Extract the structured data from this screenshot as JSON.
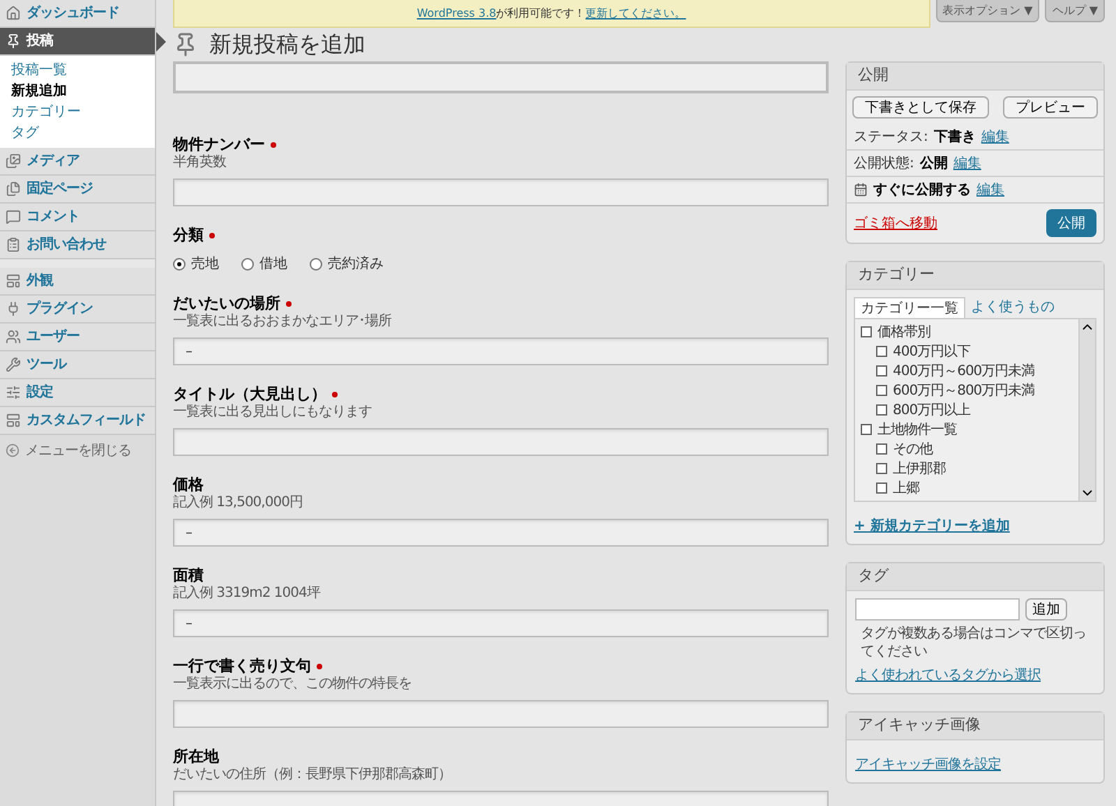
{
  "sidebar": {
    "items": [
      {
        "label": "ダッシュボード",
        "selected": false,
        "group_start": false
      },
      {
        "label": "投稿",
        "selected": true,
        "group_start": false,
        "children": [
          {
            "label": "投稿一覧",
            "selected": false
          },
          {
            "label": "新規追加",
            "selected": true
          },
          {
            "label": "カテゴリー",
            "selected": false
          },
          {
            "label": "タグ",
            "selected": false
          }
        ]
      },
      {
        "label": "メディア",
        "selected": false,
        "group_start": false
      },
      {
        "label": "固定ページ",
        "selected": false,
        "group_start": false
      },
      {
        "label": "コメント",
        "selected": false,
        "group_start": false
      },
      {
        "label": "お問い合わせ",
        "selected": false,
        "group_start": false
      },
      {
        "label": "外観",
        "selected": false,
        "group_start": true
      },
      {
        "label": "プラグイン",
        "selected": false,
        "group_start": false
      },
      {
        "label": "ユーザー",
        "selected": false,
        "group_start": false
      },
      {
        "label": "ツール",
        "selected": false,
        "group_start": false
      },
      {
        "label": "設定",
        "selected": false,
        "group_start": false
      },
      {
        "label": "カスタムフィールド",
        "selected": false,
        "group_start": false
      }
    ],
    "collapse": "メニューを閉じる"
  },
  "notice": [
    {
      "text": "WordPress 3.8",
      "link": true
    },
    {
      "text": " が利用可能です！",
      "link": false
    },
    {
      "text": "更新してください。",
      "link": true
    }
  ],
  "screen_tabs": [
    "表示オプション ▼",
    "ヘルプ ▼"
  ],
  "page_title": "新規投稿を追加",
  "fields": [
    {
      "kind": "text",
      "label": "物件ナンバー",
      "required": true,
      "hint": "半角英数"
    },
    {
      "kind": "radio",
      "label": "分類",
      "required": true,
      "options": [
        {
          "label": "売地",
          "selected": true
        },
        {
          "label": "借地",
          "selected": false
        },
        {
          "label": "売約済み",
          "selected": false
        }
      ]
    },
    {
      "kind": "text",
      "label": "だいたいの場所",
      "required": true,
      "hint": "一覧表に出るおおまかなエリア･場所",
      "value": "–"
    },
    {
      "kind": "text",
      "label": "タイトル（大見出し）",
      "required": true,
      "hint": "一覧表に出る見出しにもなります"
    },
    {
      "kind": "text",
      "label": "価格",
      "required": false,
      "hint": "記入例 13,500,000円",
      "value": "–"
    },
    {
      "kind": "text",
      "label": "面積",
      "required": false,
      "hint": "記入例 3319m2 1004坪",
      "value": "–"
    },
    {
      "kind": "text",
      "label": "一行で書く売り文句",
      "required": true,
      "hint": "一覧表示に出るので、この物件の特長を"
    },
    {
      "kind": "text",
      "label": "所在地",
      "required": false,
      "hint": "だいたいの住所（例：長野県下伊那郡高森町）"
    }
  ],
  "publish": {
    "title": "公開",
    "save_draft": "下書きとして保存",
    "preview": "プレビュー",
    "rows": [
      {
        "label": "ステータス:",
        "value": "下書き",
        "link": "編集",
        "icon": false
      },
      {
        "label": "公開状態:",
        "value": "公開",
        "link": "編集",
        "icon": false
      },
      {
        "label": "すぐに公開する",
        "link": "編集",
        "icon": true
      }
    ],
    "trash": "ゴミ箱へ移動",
    "publish_button": "公開"
  },
  "categories": {
    "title": "カテゴリー",
    "tabs": [
      {
        "label": "カテゴリー一覧",
        "selected": true
      },
      {
        "label": "よく使うもの",
        "selected": false
      }
    ],
    "tree": [
      {
        "label": "価格帯別",
        "checked": false,
        "children": [
          {
            "label": "400万円以下",
            "checked": false
          },
          {
            "label": "400万円～600万円未満",
            "checked": false
          },
          {
            "label": "600万円～800万円未満",
            "checked": false
          },
          {
            "label": "800万円以上",
            "checked": false
          }
        ]
      },
      {
        "label": "土地物件一覧",
        "checked": false,
        "children": [
          {
            "label": "その他",
            "checked": false
          },
          {
            "label": "上伊那郡",
            "checked": false
          },
          {
            "label": "上郷",
            "checked": false
          }
        ]
      }
    ],
    "add_link": "+ 新規カテゴリーを追加"
  },
  "tags": {
    "title": "タグ",
    "add_button": "追加",
    "help": "タグが複数ある場合はコンマで区切ってください",
    "choose_link": "よく使われているタグから選択"
  },
  "featured_image": {
    "title": "アイキャッチ画像",
    "link": "アイキャッチ画像を設定"
  }
}
